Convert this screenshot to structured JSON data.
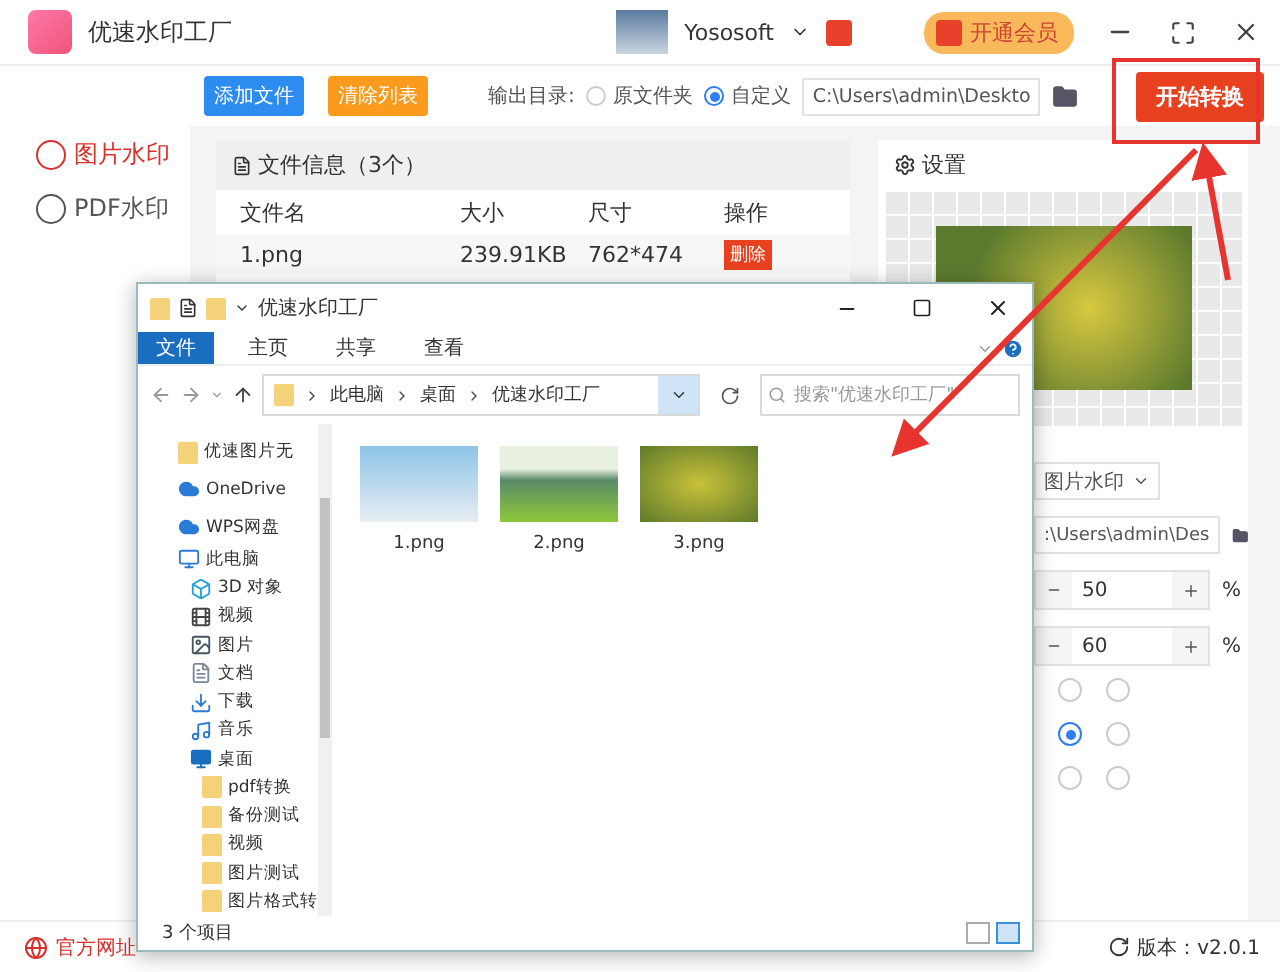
{
  "app": {
    "title": "优速水印工厂",
    "user": "Yososoft",
    "vip_button": "开通会员"
  },
  "sidebar": {
    "items": [
      {
        "label": "图片水印",
        "selected": true
      },
      {
        "label": "PDF水印",
        "selected": false
      }
    ]
  },
  "toolbar": {
    "add_button": "添加文件",
    "clear_button": "清除列表",
    "output_label": "输出目录:",
    "output_options": [
      {
        "label": "原文件夹",
        "selected": false
      },
      {
        "label": "自定义",
        "selected": true
      }
    ],
    "output_path": "C:\\Users\\admin\\Deskto",
    "start_button": "开始转换"
  },
  "file_panel": {
    "title": "文件信息（3个）",
    "columns": [
      "文件名",
      "大小",
      "尺寸",
      "操作"
    ],
    "rows": [
      {
        "name": "1.png",
        "size": "239.91KB",
        "dimensions": "762*474",
        "action": "删除"
      }
    ]
  },
  "settings": {
    "title": "设置",
    "watermark_type": "图片水印",
    "path": ":\\Users\\admin\\Des",
    "steppers": [
      {
        "value": "50",
        "unit": "%"
      },
      {
        "value": "60",
        "unit": "%"
      }
    ],
    "positions": [
      {
        "selected": false
      },
      {
        "selected": false
      },
      {
        "selected": true
      },
      {
        "selected": false
      },
      {
        "selected": false
      },
      {
        "selected": false
      }
    ]
  },
  "explorer": {
    "title": "优速水印工厂",
    "ribbon_tabs": [
      {
        "label": "文件",
        "selected": true
      },
      {
        "label": "主页",
        "selected": false
      },
      {
        "label": "共享",
        "selected": false
      },
      {
        "label": "查看",
        "selected": false
      }
    ],
    "breadcrumb": [
      "此电脑",
      "桌面",
      "优速水印工厂"
    ],
    "search_placeholder": "搜索\"优速水印工厂\"",
    "nav": [
      {
        "label": "优速图片无",
        "kind": "folder"
      },
      {
        "label": "OneDrive",
        "kind": "cloud"
      },
      {
        "label": "WPS网盘",
        "kind": "cloud"
      },
      {
        "label": "此电脑",
        "kind": "computer",
        "children": [
          {
            "label": "3D 对象",
            "kind": "cube"
          },
          {
            "label": "视频",
            "kind": "video"
          },
          {
            "label": "图片",
            "kind": "picture"
          },
          {
            "label": "文档",
            "kind": "document"
          },
          {
            "label": "下载",
            "kind": "download"
          },
          {
            "label": "音乐",
            "kind": "music"
          },
          {
            "label": "桌面",
            "kind": "desktop",
            "children": [
              {
                "label": "pdf转换",
                "kind": "folder"
              },
              {
                "label": "备份测试",
                "kind": "folder"
              },
              {
                "label": "视频",
                "kind": "folder"
              },
              {
                "label": "图片测试",
                "kind": "folder"
              },
              {
                "label": "图片格式转",
                "kind": "folder"
              }
            ]
          }
        ]
      }
    ],
    "files": [
      {
        "name": "1.png"
      },
      {
        "name": "2.png"
      },
      {
        "name": "3.png"
      }
    ],
    "status": "3 个项目"
  },
  "status_bar": {
    "website": "官方网址",
    "version": "版本：v2.0.1"
  }
}
